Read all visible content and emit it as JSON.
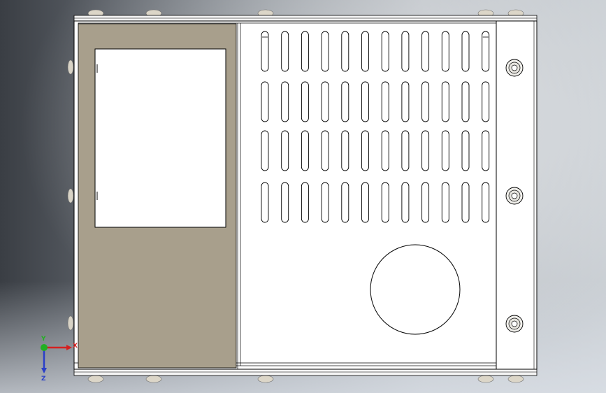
{
  "view": {
    "background_top": "#c9ced3",
    "background_left": "#3a3e44",
    "part_edge_color": "#000000",
    "panel_fill": "#ffffff",
    "side_panel_color": "#a89f8c",
    "fastener_color": "#dcd6c8"
  },
  "enclosure": {
    "slot_columns": 12,
    "slot_rows": 4,
    "side_screws": 3,
    "top_screws": 5,
    "bottom_screws": 5,
    "round_cutout": true,
    "rect_window": true
  },
  "triad": {
    "x_label": "X",
    "y_label": "Y",
    "z_label": "Z",
    "x_color": "#d42020",
    "y_color": "#22b022",
    "z_color": "#2a3fc8"
  }
}
